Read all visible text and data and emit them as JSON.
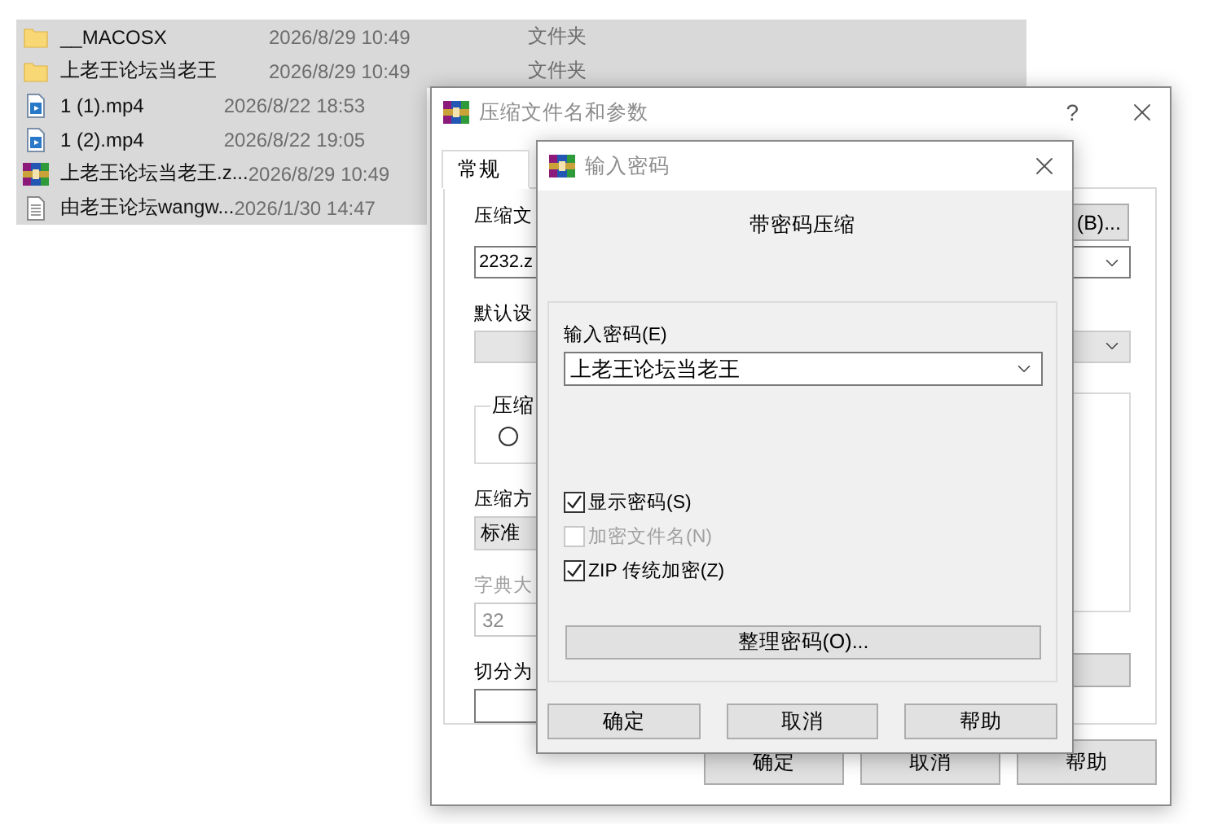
{
  "files": [
    {
      "kind": "folder",
      "name": "__MACOSX",
      "date": "2026/8/29 10:49",
      "type": "文件夹",
      "selected": true
    },
    {
      "kind": "folder",
      "name": "上老王论坛当老王",
      "date": "2026/8/29 10:49",
      "type": "文件夹",
      "selected": true
    },
    {
      "kind": "video",
      "name": "1 (1).mp4",
      "date": "2026/8/22 18:53",
      "selected": true
    },
    {
      "kind": "video",
      "name": "1 (2).mp4",
      "date": "2026/8/22 19:05",
      "selected": true
    },
    {
      "kind": "archive",
      "name": "上老王论坛当老王.z...",
      "date": "2026/8/29 10:49",
      "selected": true
    },
    {
      "kind": "text",
      "name": "由老王论坛wangw...",
      "date": "2026/1/30 14:47",
      "selected": true
    }
  ],
  "archive_dialog": {
    "title": "压缩文件名和参数",
    "help_symbol": "?",
    "tab": {
      "label": "常规",
      "selected": true
    },
    "browse_button": "(B)...",
    "archive_name_label": "压缩文",
    "archive_name_value": "2232.z",
    "profile_label": "默认设",
    "format_group_label": "压缩",
    "format_radio": {
      "selected": false
    },
    "method_label": "压缩方",
    "method_value": "标准",
    "dictionary_label": "字典大",
    "dictionary_disabled": true,
    "dictionary_value": "32",
    "split_label": "切分为",
    "buttons": [
      "确定",
      "取消",
      "帮助"
    ]
  },
  "password_dialog": {
    "title": "输入密码",
    "heading": "带密码压缩",
    "password_label": "输入密码(E)",
    "password_value": "上老王论坛当老王",
    "checkboxes": [
      {
        "label": "显示密码(S)",
        "checked": true,
        "disabled": false
      },
      {
        "label": "加密文件名(N)",
        "checked": false,
        "disabled": true
      },
      {
        "label": "ZIP 传统加密(Z)",
        "checked": true,
        "disabled": false
      }
    ],
    "organize_button": "整理密码(O)...",
    "buttons": [
      "确定",
      "取消",
      "帮助"
    ]
  }
}
